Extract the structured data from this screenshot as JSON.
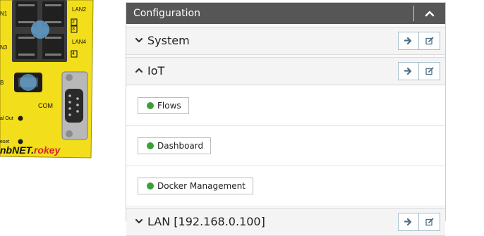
{
  "device": {
    "port_labels": [
      "LAN2",
      "LAN4"
    ],
    "partial_labels": [
      "N1",
      "N3",
      "B",
      "al Out",
      "eset"
    ],
    "port_numbers": [
      "2",
      "3",
      "4"
    ],
    "com_label": "COM",
    "brand_text": "nbNET.",
    "brand_accent": "rokey"
  },
  "panel": {
    "title": "Configuration",
    "collapse_icon": "chevron-up-icon",
    "sections": [
      {
        "title": "System",
        "state": "collapsed"
      },
      {
        "title": "IoT",
        "state": "expanded"
      },
      {
        "title": "LAN [192.168.0.100]",
        "state": "collapsed"
      }
    ],
    "iot_items": [
      {
        "label": "Flows",
        "status_color": "#3aa235"
      },
      {
        "label": "Dashboard",
        "status_color": "#3aa235"
      },
      {
        "label": "Docker Management",
        "status_color": "#3aa235"
      }
    ]
  },
  "colors": {
    "header_bg": "#565656",
    "device_yellow": "#f5e11e",
    "status_green": "#3aa235",
    "icon_blue": "#4a6f86"
  }
}
